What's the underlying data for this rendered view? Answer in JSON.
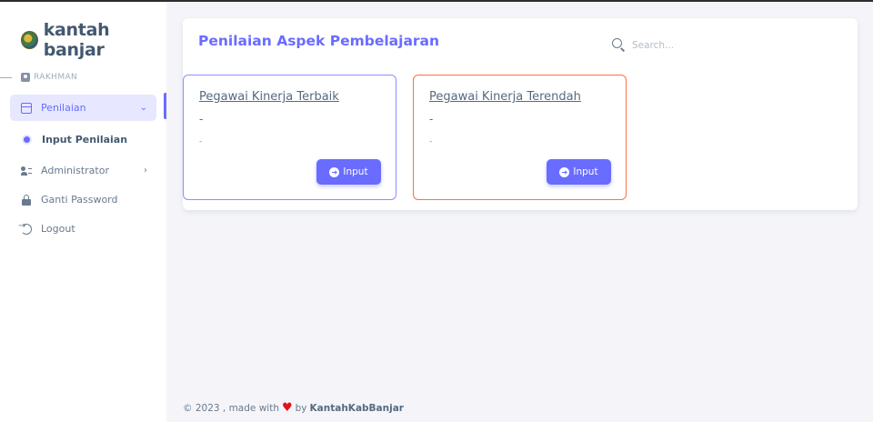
{
  "brand": {
    "name": "kantah banjar"
  },
  "sidebar": {
    "user_header": "RAKHMAN",
    "items": [
      {
        "label": "Penilaian",
        "icon": "calendar-icon",
        "active": true,
        "chevron": "⌄"
      },
      {
        "label": "Input Penilaian",
        "icon": "dot-icon",
        "sub": true
      },
      {
        "label": "Administrator",
        "icon": "users-icon",
        "chevron": "›"
      },
      {
        "label": "Ganti Password",
        "icon": "lock-icon"
      },
      {
        "label": "Logout",
        "icon": "logout-icon"
      }
    ]
  },
  "main": {
    "title": "Penilaian Aspek Pembelajaran",
    "search": {
      "placeholder": "Search..."
    },
    "cards": [
      {
        "title": "Pegawai Kinerja Terbaik",
        "value": "-",
        "sub_value": "-",
        "button_label": "Input",
        "border_color": "#8d8fff"
      },
      {
        "title": "Pegawai Kinerja Terendah",
        "value": "-",
        "sub_value": "-",
        "button_label": "Input",
        "border_color": "#ff6f4a"
      }
    ]
  },
  "footer": {
    "prefix": "© 2023 , made with",
    "by": "by",
    "author": "KantahKabBanjar"
  },
  "colors": {
    "accent": "#696cff",
    "accent_light": "#e7e7ff",
    "danger": "#ff6f4a",
    "heart": "#e0121b"
  }
}
